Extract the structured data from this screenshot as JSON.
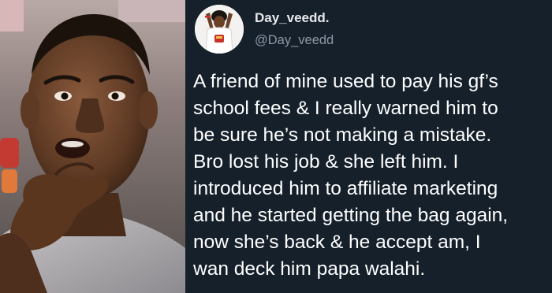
{
  "tweet": {
    "display_name": "Day_veedd.",
    "handle": "@Day_veedd",
    "body_lines": [
      "A friend of mine used to pay his gf’s",
      "school fees & I really warned him to",
      "be sure he’s not making a mistake.",
      "Bro lost his job & she left him. I",
      "introduced him to affiliate marketing",
      "and he started getting the bag again,",
      "now she’s back & he accept am, I",
      "wan deck him papa walahi."
    ]
  },
  "colors": {
    "tweet_background": "#15202b",
    "name_text": "#e7e9ea",
    "handle_text": "#8b98a5",
    "body_text": "#ffffff"
  },
  "icons": {
    "photo": "thinking-man-photo",
    "avatar": "user-avatar"
  }
}
